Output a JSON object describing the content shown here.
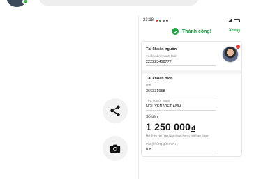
{
  "chat": {
    "actions": [
      "share",
      "camera"
    ]
  },
  "phone": {
    "status_bar": {
      "time": "23:18"
    },
    "header": {
      "success_text": "Thành công!",
      "done_label": "Xong"
    },
    "source_account": {
      "section_title": "Tài khoản nguồn",
      "payment_account_label": "Tài khoản thanh toán",
      "payment_account_number": "222223456777"
    },
    "destination_account": {
      "section_title": "Tài khoản đích",
      "bank_name": "VIB",
      "account_number": "366331958",
      "recipient_label": "Tên người nhận",
      "recipient_name": "NGUYEN VIET ANH"
    },
    "amount": {
      "label": "Số tiền",
      "value": "1 250 000",
      "currency": "đ",
      "in_words": "Một Triệu Hai Trăm Năm Mươi Nghìn Việt Nam Đồng"
    },
    "fee": {
      "label": "Phí (không gồm VAT)",
      "value": "0 đ"
    }
  },
  "colors": {
    "success_green": "#25a244",
    "button_bg": "#f2f2f2"
  },
  "icons": [
    "share-icon",
    "camera-icon",
    "check-circle-icon",
    "user-avatar"
  ]
}
